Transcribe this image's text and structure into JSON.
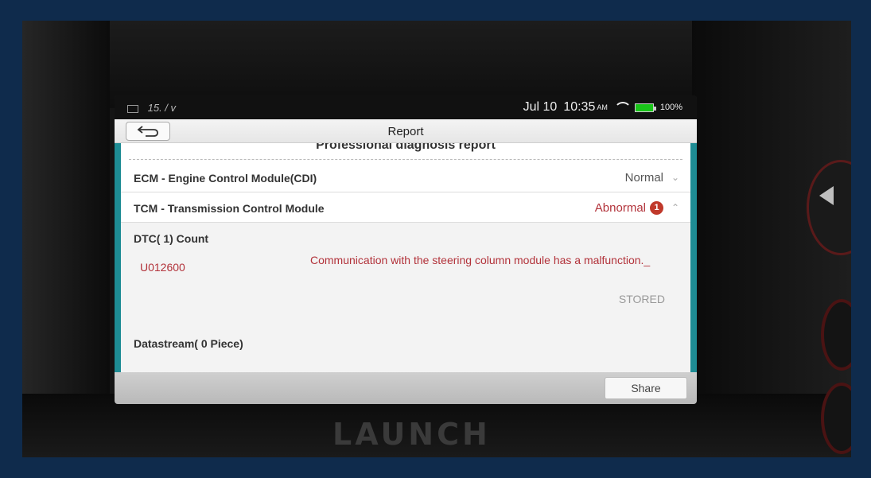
{
  "status_bar": {
    "left_text": "15. / v",
    "date": "Jul 10",
    "time": "10:35",
    "ampm": "AM",
    "battery": "100%"
  },
  "app_bar": {
    "title": "Report",
    "back_icon": "back-arrow-icon"
  },
  "report": {
    "heading": "Professional diagnosis report",
    "modules": [
      {
        "name": "ECM - Engine Control Module(CDI)",
        "status": "Normal",
        "expanded": false
      },
      {
        "name": "TCM - Transmission Control Module",
        "status": "Abnormal",
        "badge": "1",
        "expanded": true
      }
    ],
    "detail": {
      "dtc_count_label": "DTC( 1) Count",
      "dtcs": [
        {
          "code": "U012600",
          "description": "Communication with the steering column module has a malfunction._",
          "state": "STORED"
        }
      ],
      "datastream_label": "Datastream( 0 Piece)"
    }
  },
  "footer": {
    "share_label": "Share"
  },
  "device": {
    "brand": "LAUNCH"
  },
  "colors": {
    "teal": "#1e8c94",
    "error_red": "#b2323a",
    "badge_red": "#c0392b"
  }
}
